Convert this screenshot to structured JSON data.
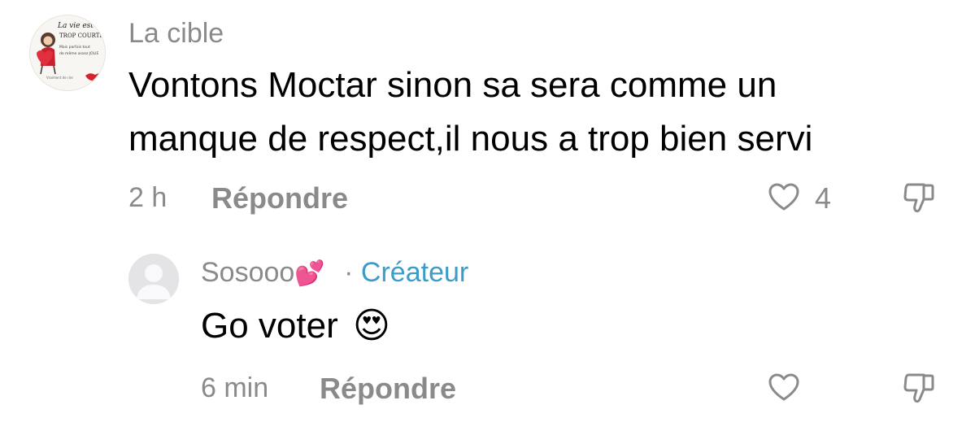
{
  "comments": [
    {
      "username": "La cible",
      "text_line1": "Vontons Moctar sinon sa sera comme un",
      "text_line2": "manque de respect,il nous a trop bien servi",
      "time": "2 h",
      "reply_label": "Répondre",
      "like_count": "4",
      "avatar_text": {
        "l1": "La vie est",
        "l2": "TROP COURTE",
        "l3": "Mais parfois tout",
        "l4": "de même assez JOLIE",
        "l5": "Vraiment de rire"
      }
    },
    {
      "username": "Sosooo",
      "username_emoji": "💕",
      "separator": "·",
      "creator_label": "Créateur",
      "text": "Go voter",
      "text_emoji": "😍",
      "time": "6 min",
      "reply_label": "Répondre"
    }
  ],
  "colors": {
    "secondary_text": "#8a8a8a",
    "creator_accent": "#3b9bc9",
    "icon_gray": "#8a8a8a"
  },
  "icons": {
    "like": "heart-outline-icon",
    "dislike": "thumbs-down-outline-icon",
    "default_avatar": "user-silhouette-icon"
  }
}
